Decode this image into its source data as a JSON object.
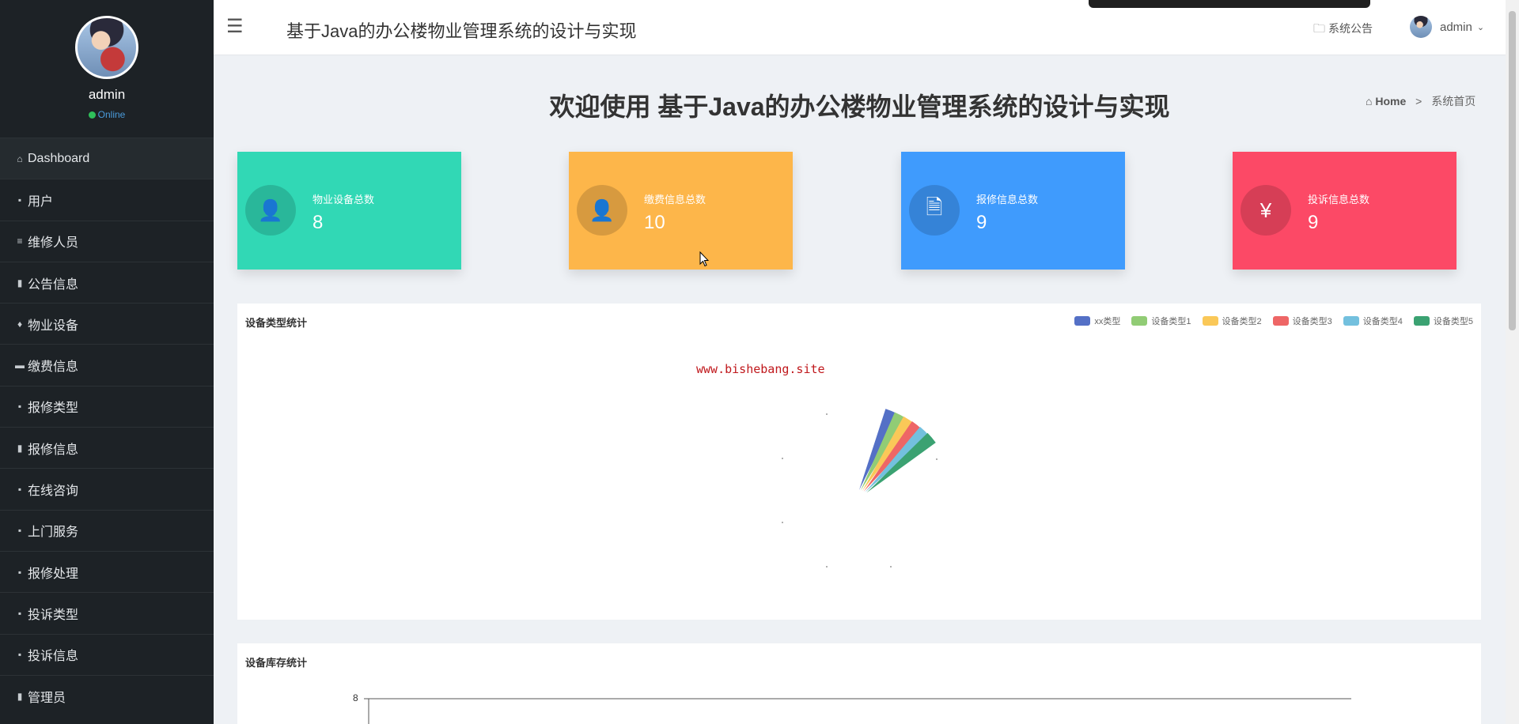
{
  "sidebar": {
    "user": {
      "name": "admin",
      "status": "Online"
    },
    "items": [
      {
        "label": "Dashboard",
        "icon": "home-icon"
      },
      {
        "label": "用户",
        "icon": "grid-icon"
      },
      {
        "label": "维修人员",
        "icon": "sliders-icon"
      },
      {
        "label": "公告信息",
        "icon": "clipboard-icon"
      },
      {
        "label": "物业设备",
        "icon": "trophy-icon"
      },
      {
        "label": "缴费信息",
        "icon": "car-icon"
      },
      {
        "label": "报修类型",
        "icon": "grid-icon"
      },
      {
        "label": "报修信息",
        "icon": "bar-chart-icon"
      },
      {
        "label": "在线咨询",
        "icon": "grid-icon"
      },
      {
        "label": "上门服务",
        "icon": "grid-icon"
      },
      {
        "label": "报修处理",
        "icon": "grid-icon"
      },
      {
        "label": "投诉类型",
        "icon": "grid-icon"
      },
      {
        "label": "投诉信息",
        "icon": "grid-icon"
      },
      {
        "label": "管理员",
        "icon": "clipboard-icon"
      }
    ]
  },
  "header": {
    "title": "基于Java的办公楼物业管理系统的设计与实现",
    "notice": "系统公告",
    "user": "admin"
  },
  "main": {
    "welcome": "欢迎使用 基于Java的办公楼物业管理系统的设计与实现",
    "breadcrumb": {
      "home": "Home",
      "current": "系统首页"
    },
    "stats": [
      {
        "label": "物业设备总数",
        "value": "8",
        "color": "#31d8b5",
        "icon": "user-icon"
      },
      {
        "label": "缴费信息总数",
        "value": "10",
        "color": "#fdb64a",
        "icon": "user-icon"
      },
      {
        "label": "报修信息总数",
        "value": "9",
        "color": "#3f9bfd",
        "icon": "document-icon"
      },
      {
        "label": "投诉信息总数",
        "value": "9",
        "color": "#fc4966",
        "icon": "yen-icon"
      }
    ]
  },
  "panels": {
    "pie_title": "设备类型统计",
    "bar_title": "设备库存统计",
    "watermark": "www.bishebang.site"
  },
  "chart_data": [
    {
      "type": "pie",
      "title": "设备类型统计",
      "legend_position": "top-right",
      "categories": [
        "xx类型",
        "设备类型1",
        "设备类型2",
        "设备类型3",
        "设备类型4",
        "设备类型5"
      ],
      "colors": [
        "#5470c6",
        "#91cc75",
        "#fac858",
        "#ee6666",
        "#73c0de",
        "#3ba272"
      ]
    },
    {
      "type": "bar",
      "title": "设备库存统计",
      "yticks": [
        "8"
      ]
    }
  ]
}
